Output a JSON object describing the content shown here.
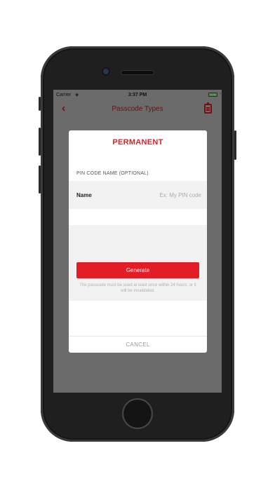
{
  "status_bar": {
    "carrier": "Carrier",
    "time": "3:37 PM"
  },
  "nav": {
    "title": "Passcode Types",
    "back_icon": "chevron-left-icon",
    "action_icon": "clipboard-icon"
  },
  "modal": {
    "title": "PERMANENT",
    "section_label": "PIN CODE NAME (OPTIONAL)",
    "name_label": "Name",
    "name_placeholder": "Ex: My PIN code",
    "name_value": "",
    "generate_label": "Generate",
    "hint": "The passcode must be used at least once within 24 hours, or it will be invalidated.",
    "cancel_label": "CANCEL"
  },
  "colors": {
    "accent": "#e21d26",
    "nav_tint": "#7a0e0e",
    "overlay": "#6b6b6b"
  }
}
